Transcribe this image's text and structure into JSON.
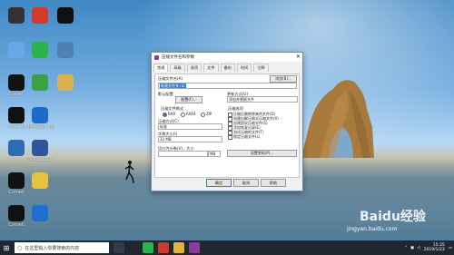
{
  "desktop": {
    "icons": [
      {
        "label": "",
        "color": "#333333"
      },
      {
        "label": "",
        "color": "#d33a2c"
      },
      {
        "label": "",
        "color": "#111111"
      },
      {
        "label": "",
        "color": "#6aa7e6"
      },
      {
        "label": "",
        "color": "#2ab34a"
      },
      {
        "label": "",
        "color": "#4f7fb3"
      },
      {
        "label": "Cornell",
        "color": "#111111"
      },
      {
        "label": "",
        "color": "#3aa245"
      },
      {
        "label": "",
        "color": "#d7b24d"
      },
      {
        "label": "Cornell",
        "color": "#111111"
      },
      {
        "label": "Microsoft Edge",
        "color": "#1e6bc7"
      },
      {
        "label": "",
        "color": "#2d6db5"
      },
      {
        "label": "Word 2016",
        "color": "#2b579a"
      },
      {
        "label": "Cornell",
        "color": "#111111"
      },
      {
        "label": "",
        "color": "#e8c33b"
      },
      {
        "label": "Cornell",
        "color": "#111111"
      },
      {
        "label": "",
        "color": "#1f6fd1"
      }
    ]
  },
  "dialog": {
    "title": "压缩文件名和参数",
    "close": "✕",
    "tabs": [
      "常规",
      "高级",
      "选项",
      "文件",
      "备份",
      "时间",
      "注释"
    ],
    "filename_label": "压缩文件名(A)",
    "browse_button": "浏览(B)...",
    "filename_value": "新建文件夹.rar",
    "profile_label": "默认配置",
    "profile_button": "配置(F)...",
    "update_label": "更新方式(U)",
    "update_value": "添加并替换文件",
    "format_label": "压缩文件格式",
    "formats": [
      "RAR",
      "RAR4",
      "ZIP"
    ],
    "method_label": "压缩方式(C)",
    "method_value": "标准",
    "split_label": "字典大小(I)",
    "split_value": "32 MB",
    "volume_label": "切分为分卷(V)，大小",
    "volume_unit": "MB",
    "options_label": "压缩选项",
    "options": [
      "压缩后删除原来的文件(D)",
      "创建自解压格式压缩文件(X)",
      "创建固实压缩文件(S)",
      "添加恢复记录(E)",
      "测试压缩的文件(T)",
      "锁定压缩文件(L)"
    ],
    "password_button": "设置密码(P)...",
    "ok_button": "确定",
    "cancel_button": "取消",
    "help_button": "帮助"
  },
  "taskbar": {
    "search_placeholder": "在这里输入你要搜索的内容",
    "time": "15:35",
    "date": "2019/1/23"
  },
  "watermark": {
    "text": "Baidu经验",
    "url": "jingyan.baidu.com"
  }
}
